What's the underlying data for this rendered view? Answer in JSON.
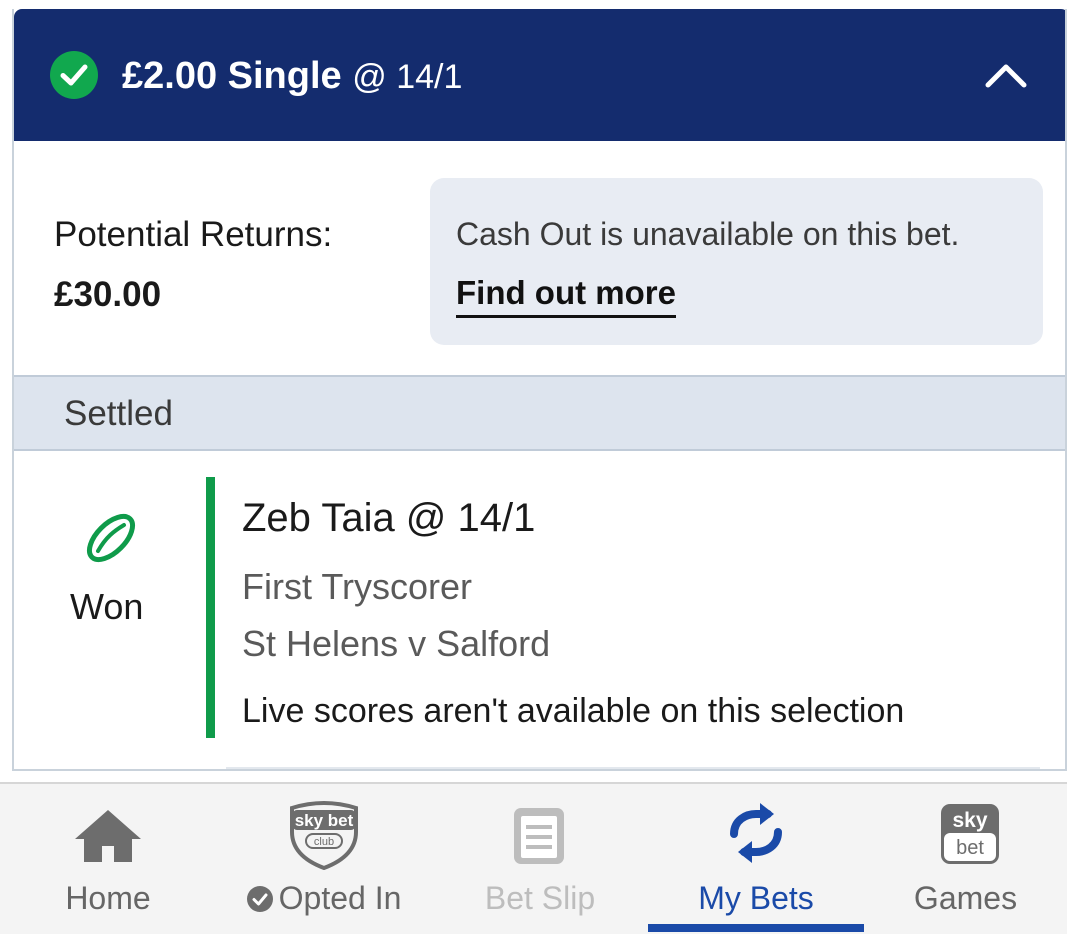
{
  "bet_header": {
    "stake_type": "£2.00 Single",
    "odds": "@ 14/1"
  },
  "returns": {
    "label": "Potential Returns:",
    "value": "£30.00"
  },
  "cashout": {
    "message": "Cash Out is unavailable on this bet.",
    "link": "Find out more"
  },
  "status_bar": {
    "label": "Settled"
  },
  "selection": {
    "result": "Won",
    "name": "Zeb Taia @ 14/1",
    "market": "First Tryscorer",
    "event": "St Helens v Salford",
    "note": "Live scores aren't available on this selection"
  },
  "nav": {
    "items": [
      {
        "label": "Home",
        "icon": "home-icon"
      },
      {
        "label": "Opted In",
        "icon": "sky-bet-club-icon",
        "badge_text": "sky bet club"
      },
      {
        "label": "Bet Slip",
        "icon": "bet-slip-icon"
      },
      {
        "label": "My Bets",
        "icon": "my-bets-icon",
        "active": true
      },
      {
        "label": "Games",
        "icon": "sky-bet-games-icon",
        "badge_text": "sky bet"
      }
    ]
  },
  "colors": {
    "header_bg": "#142c6e",
    "won_green": "#0f9b4a",
    "active_blue": "#1a4aa8"
  }
}
